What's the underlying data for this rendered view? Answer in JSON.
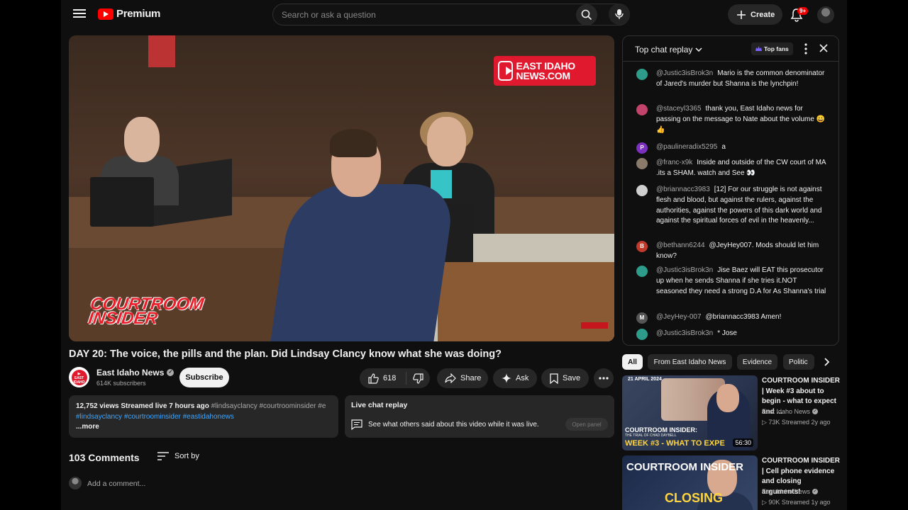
{
  "header": {
    "brand": "Premium",
    "search_placeholder": "Search or ask a question",
    "create_label": "Create",
    "notif_count": "9+"
  },
  "video": {
    "title": "DAY 20: The voice, the pills and the plan. Did Lindsay Clancy know what she was doing?",
    "overlay_brand": "EAST IDAHO NEWS.COM",
    "overlay_show": "COURTROOM INSIDER",
    "channel_name": "East Idaho News",
    "channel_subs": "614K subscribers",
    "subscribe_label": "Subscribe",
    "likes": "618",
    "share_label": "Share",
    "ask_label": "Ask",
    "save_label": "Save"
  },
  "description": {
    "meta": "12,752 views  Streamed live 7 hours ago",
    "tags_inline": " #lindsayclancy #courtroominsider #e",
    "tags": "#lindsayclancy #courtroominsider #eastidahonews",
    "more": "...more"
  },
  "live_replay": {
    "title": "Live chat replay",
    "desc": "See what others said about this video while it was live.",
    "button": "Open panel"
  },
  "comments": {
    "count": "103 Comments",
    "sort_label": "Sort by",
    "add_placeholder": "Add a comment..."
  },
  "chat": {
    "title": "Top chat replay",
    "top_fans": "Top fans",
    "messages": [
      {
        "author": "@Justic3isBrok3n",
        "text": "Mario is the common denominator of Jared's murder but Shanna is the lynchpin!",
        "color": "#2e9c8a",
        "initial": ""
      },
      {
        "author": "@staceyl3365",
        "text": "thank you, East Idaho news for passing on the message to Nate about the volume 😀👍",
        "color": "#c2446a",
        "initial": ""
      },
      {
        "author": "@paulineradix5295",
        "text": "a",
        "color": "#7b2fbf",
        "initial": "P"
      },
      {
        "author": "@franc-x9k",
        "text": "Inside and outside of the CW court of MA .its a SHAM. watch and See 👀",
        "color": "#8a7a6a",
        "initial": ""
      },
      {
        "author": "@briannacc3983",
        "text": "[12] For our struggle is not against flesh and blood, but against the rulers, against the authorities, against the powers of this dark world and against the spiritual forces of evil in the heavenly...",
        "color": "#cfcfcf",
        "initial": ""
      },
      {
        "author": "@bethann6244",
        "text": "@JeyHey007. Mods should let him know?",
        "color": "#c0392b",
        "initial": "B"
      },
      {
        "author": "@Justic3isBrok3n",
        "text": "Jise Baez will EAT this prosecutor up when he sends Shanna if she tries it.NOT seasoned they need a strong D.A for As Shanna's trial",
        "color": "#2e9c8a",
        "initial": ""
      },
      {
        "author": "@JeyHey-007",
        "text": "@briannacc3983 Amen!",
        "color": "#555555",
        "initial": "M"
      },
      {
        "author": "@Justic3isBrok3n",
        "text": "* Jose",
        "color": "#2e9c8a",
        "initial": ""
      }
    ]
  },
  "chips": [
    "All",
    "From East Idaho News",
    "Evidence",
    "Politic"
  ],
  "recommendations": [
    {
      "title": "COURTROOM INSIDER | Week #3 about to begin - what to expect and ...",
      "channel": "East Idaho News",
      "meta": "▷ 73K  Streamed 2y ago",
      "duration": "56:30",
      "thumb_date": "21 APRIL 2024",
      "thumb_label": "COURTROOM INSIDER:",
      "thumb_sub": "THE TRIAL OF CHAD DAYBELL",
      "thumb_week": "WEEK #3 - WHAT TO EXPE"
    },
    {
      "title": "COURTROOM INSIDER | Cell phone evidence and closing arguments!",
      "channel": "East Idaho News",
      "meta": "▷ 90K  Streamed 1y ago",
      "thumb_title": "COURTROOM INSIDER",
      "thumb_closing": "CLOSING"
    }
  ]
}
